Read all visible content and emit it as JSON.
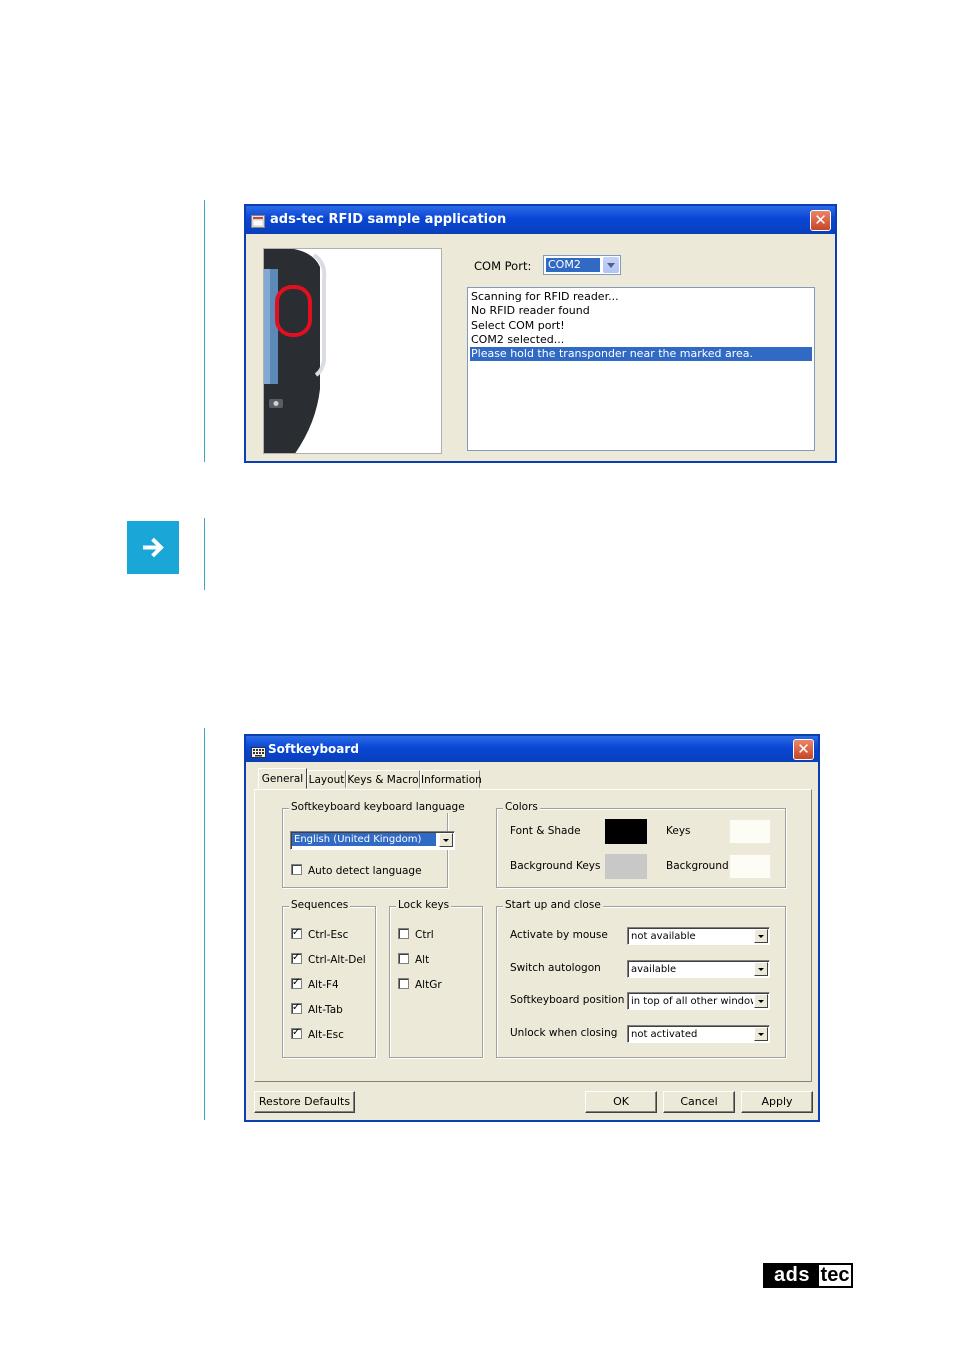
{
  "rfid_window": {
    "title": "ads-tec RFID sample application",
    "com_port_label": "COM Port:",
    "com_port_value": "COM2",
    "log_lines": [
      "Scanning for RFID reader...",
      "No RFID reader found",
      "Select COM port!",
      "COM2 selected...",
      "Please hold the transponder near the marked area."
    ],
    "selected_line_index": 4
  },
  "note": {
    "icon": "arrow-right-icon",
    "color": "#1aa6d6"
  },
  "softkeyboard_window": {
    "title": "Softkeyboard",
    "tabs": [
      "General",
      "Layout",
      "Keys & Macro",
      "Information"
    ],
    "active_tab": "General",
    "language_group": {
      "legend": "Softkeyboard keyboard language",
      "language_value": "English (United Kingdom)",
      "auto_detect_label": "Auto detect language",
      "auto_detect_checked": false
    },
    "colors_group": {
      "legend": "Colors",
      "font_shade_label": "Font & Shade",
      "font_shade_color": "#000000",
      "keys_label": "Keys",
      "keys_color": "#fdfdf6",
      "background_keys_label": "Background Keys",
      "background_keys_color": "#c8c8c8",
      "background_label": "Background",
      "background_color": "#fdfdf6"
    },
    "sequences_group": {
      "legend": "Sequences",
      "items": [
        {
          "label": "Ctrl-Esc",
          "checked": true
        },
        {
          "label": "Ctrl-Alt-Del",
          "checked": true
        },
        {
          "label": "Alt-F4",
          "checked": true
        },
        {
          "label": "Alt-Tab",
          "checked": true
        },
        {
          "label": "Alt-Esc",
          "checked": true
        }
      ]
    },
    "lock_keys_group": {
      "legend": "Lock keys",
      "items": [
        {
          "label": "Ctrl",
          "checked": false
        },
        {
          "label": "Alt",
          "checked": false
        },
        {
          "label": "AltGr",
          "checked": false
        }
      ]
    },
    "startup_group": {
      "legend": "Start up and close",
      "rows": [
        {
          "label": "Activate by mouse",
          "value": "not available"
        },
        {
          "label": "Switch autologon",
          "value": "available"
        },
        {
          "label": "Softkeyboard position",
          "value": "in top of all other windows"
        },
        {
          "label": "Unlock when closing",
          "value": "not activated"
        }
      ]
    },
    "buttons": {
      "restore": "Restore Defaults",
      "ok": "OK",
      "cancel": "Cancel",
      "apply": "Apply"
    }
  },
  "logo": {
    "text_left": "ads",
    "text_right": "tec"
  }
}
